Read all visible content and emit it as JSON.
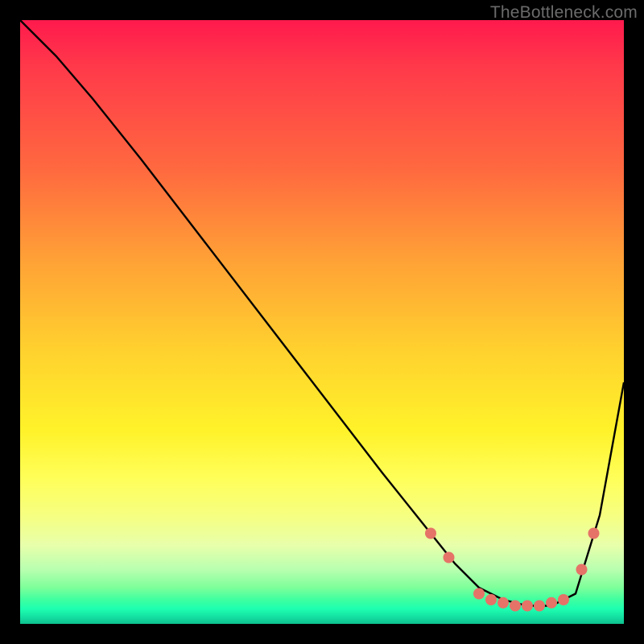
{
  "watermark": {
    "text": "TheBottleneck.com"
  },
  "chart_data": {
    "type": "line",
    "title": "",
    "xlabel": "",
    "ylabel": "",
    "xlim": [
      0,
      100
    ],
    "ylim": [
      0,
      100
    ],
    "grid": false,
    "legend": "none",
    "gradient_stops": [
      {
        "pos": 0.0,
        "color": "#ff1a4d"
      },
      {
        "pos": 0.25,
        "color": "#ff6a3f"
      },
      {
        "pos": 0.55,
        "color": "#ffd22e"
      },
      {
        "pos": 0.8,
        "color": "#f8ff70"
      },
      {
        "pos": 0.95,
        "color": "#3effa0"
      },
      {
        "pos": 1.0,
        "color": "#0fc08e"
      }
    ],
    "series": [
      {
        "name": "curve",
        "x": [
          0,
          6,
          12,
          20,
          30,
          40,
          50,
          60,
          68,
          72,
          76,
          80,
          84,
          88,
          92,
          96,
          100
        ],
        "y": [
          100,
          94,
          87,
          77,
          64,
          51,
          38,
          25,
          15,
          10,
          6,
          4,
          3,
          3,
          5,
          18,
          40
        ]
      }
    ],
    "markers": {
      "name": "salmon-dots",
      "color": "#e57368",
      "radius_px": 7,
      "points": [
        {
          "x": 68,
          "y": 15
        },
        {
          "x": 71,
          "y": 11
        },
        {
          "x": 76,
          "y": 5
        },
        {
          "x": 78,
          "y": 4
        },
        {
          "x": 80,
          "y": 3.5
        },
        {
          "x": 82,
          "y": 3
        },
        {
          "x": 84,
          "y": 3
        },
        {
          "x": 86,
          "y": 3
        },
        {
          "x": 88,
          "y": 3.5
        },
        {
          "x": 90,
          "y": 4
        },
        {
          "x": 93,
          "y": 9
        },
        {
          "x": 95,
          "y": 15
        }
      ]
    }
  }
}
